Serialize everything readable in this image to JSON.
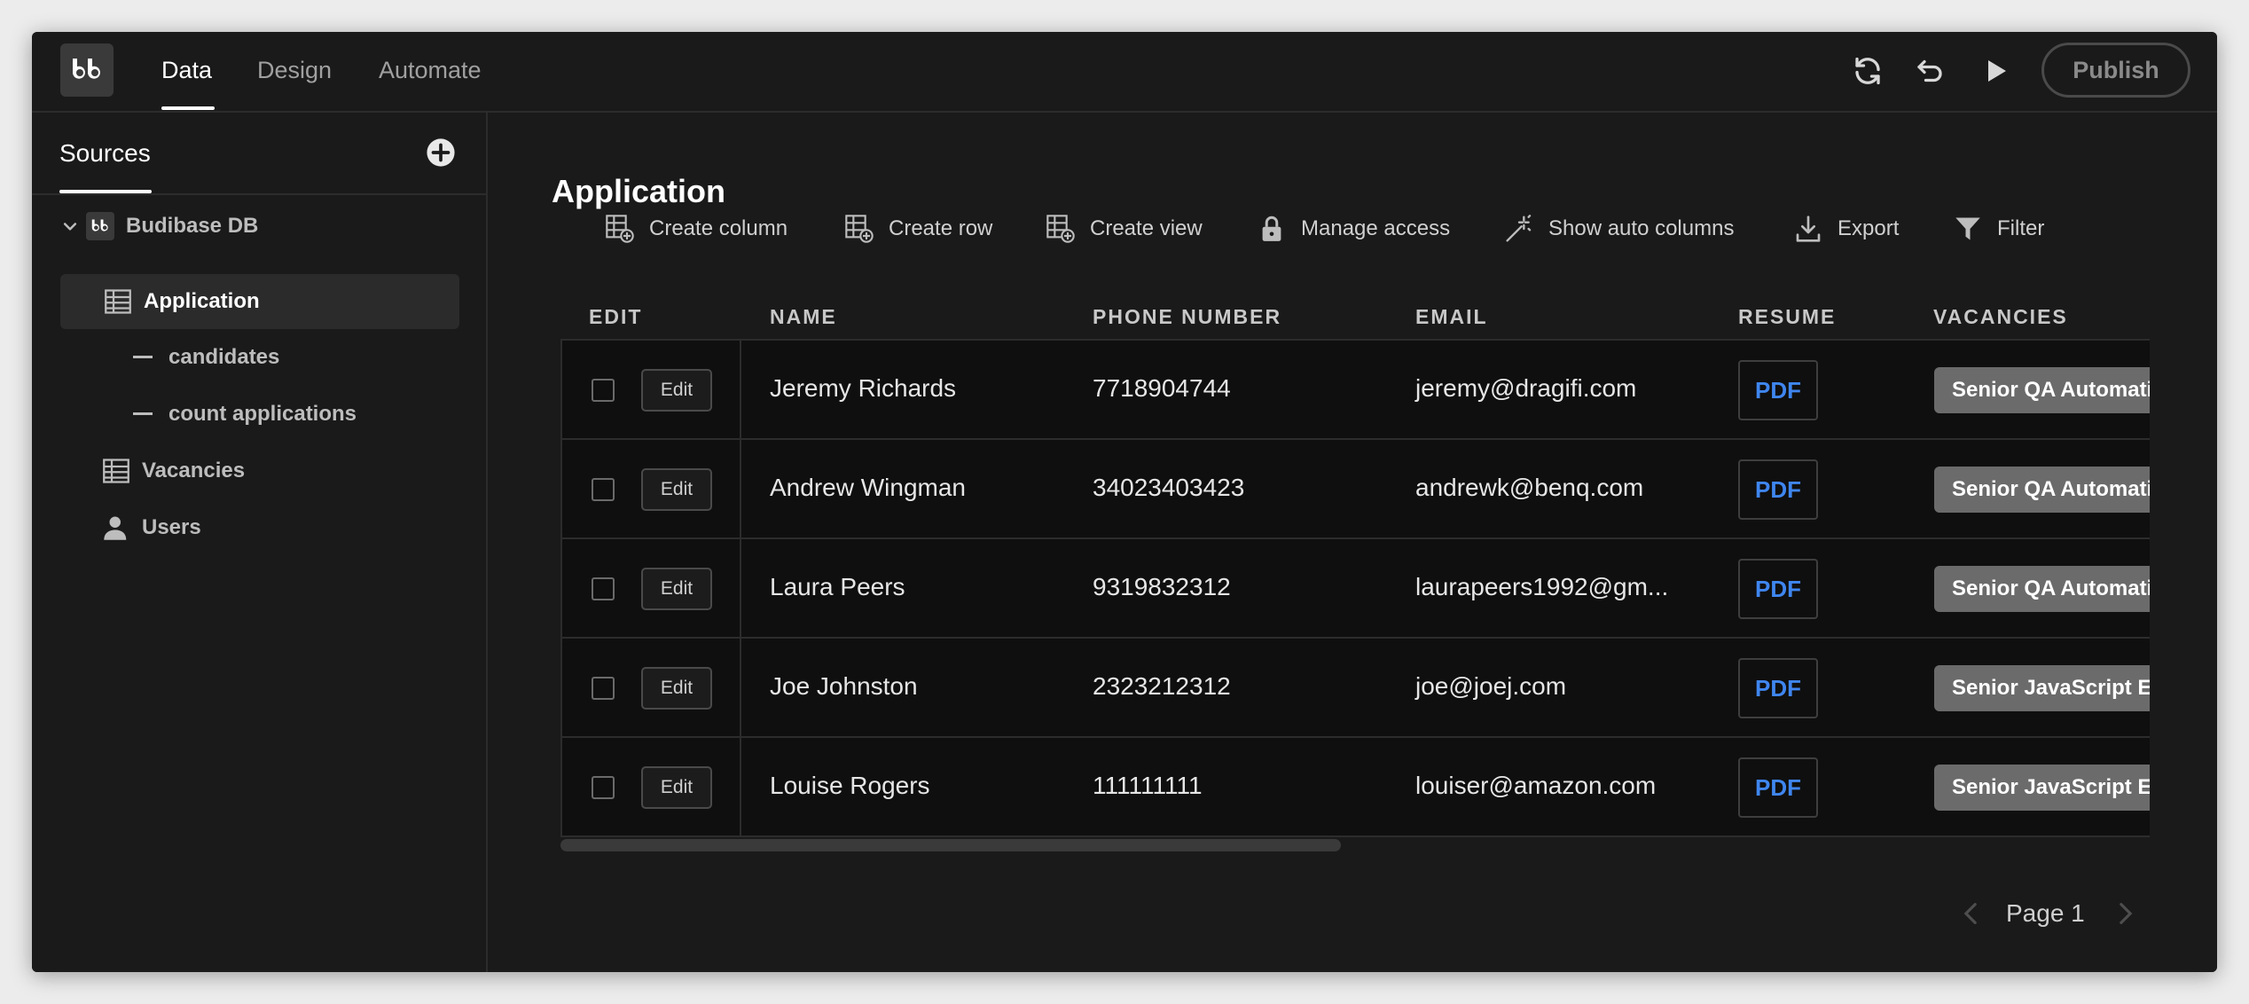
{
  "topbar": {
    "logo_text": "bb",
    "tabs": [
      {
        "label": "Data",
        "active": true
      },
      {
        "label": "Design",
        "active": false
      },
      {
        "label": "Automate",
        "active": false
      }
    ],
    "publish_label": "Publish"
  },
  "sidebar": {
    "title": "Sources",
    "tree": [
      {
        "label": "Budibase DB",
        "icon": "budibase-icon",
        "level": 0
      },
      {
        "label": "Application",
        "icon": "table-icon",
        "level": 1,
        "selected": true
      },
      {
        "label": "candidates",
        "icon": "dash-icon",
        "level": 2
      },
      {
        "label": "count applications",
        "icon": "dash-icon",
        "level": 2
      },
      {
        "label": "Vacancies",
        "icon": "table-icon",
        "level": 1
      },
      {
        "label": "Users",
        "icon": "user-icon",
        "level": 1
      }
    ]
  },
  "main": {
    "title": "Application",
    "toolbar": [
      {
        "label": "Create column",
        "icon": "create-column-icon"
      },
      {
        "label": "Create row",
        "icon": "create-row-icon"
      },
      {
        "label": "Create view",
        "icon": "create-view-icon"
      },
      {
        "label": "Manage access",
        "icon": "lock-icon"
      },
      {
        "label": "Show auto columns",
        "icon": "magic-wand-icon"
      },
      {
        "label": "Export",
        "icon": "download-icon"
      },
      {
        "label": "Filter",
        "icon": "filter-icon"
      }
    ],
    "table": {
      "columns": [
        "EDIT",
        "NAME",
        "PHONE NUMBER",
        "EMAIL",
        "RESUME",
        "VACANCIES"
      ],
      "edit_label": "Edit",
      "rows": [
        {
          "name": "Jeremy Richards",
          "phone": "7718904744",
          "email": "jeremy@dragifi.com",
          "resume": "PDF",
          "vacancy": "Senior QA Automation"
        },
        {
          "name": "Andrew Wingman",
          "phone": "34023403423",
          "email": "andrewk@benq.com",
          "resume": "PDF",
          "vacancy": "Senior QA Automation"
        },
        {
          "name": "Laura Peers",
          "phone": "9319832312",
          "email": "laurapeers1992@gm...",
          "resume": "PDF",
          "vacancy": "Senior QA Automation"
        },
        {
          "name": "Joe Johnston",
          "phone": "2323212312",
          "email": "joe@joej.com",
          "resume": "PDF",
          "vacancy": "Senior JavaScript Engineer"
        },
        {
          "name": "Louise Rogers",
          "phone": "111111111",
          "email": "louiser@amazon.com",
          "resume": "PDF",
          "vacancy": "Senior JavaScript Engineer"
        }
      ]
    },
    "pagination": {
      "label": "Page 1"
    }
  },
  "colors": {
    "background": "#1a1a1a",
    "table_bg": "#0f0f0f",
    "accent_link": "#3f86f0",
    "chip": "#6b6b6b"
  }
}
